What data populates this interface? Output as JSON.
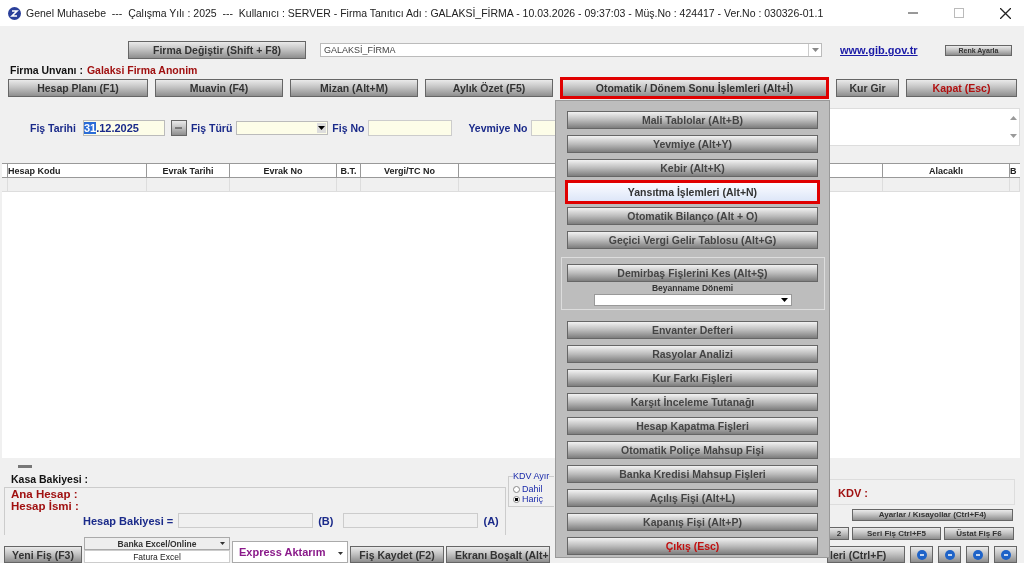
{
  "window": {
    "title": "Genel Muhasebe  ---  Çalışma Yılı : 2025  ---  Kullanıcı : SERVER - Firma Tanıtıcı Adı : GALAKSİ_FİRMA - 10.03.2026 - 09:37:03 - Müş.No : 424417 - Ver.No : 030326-01.1"
  },
  "top_bar": {
    "firma_button": "Firma Değiştir (Shift + F8)",
    "firma_combo": "GALAKSİ_FİRMA",
    "link": "www.gib.gov.tr",
    "color_button": "Renk Ayarla"
  },
  "firma_unvani": {
    "label": "Firma Unvanı :",
    "value": "Galaksi Firma Anonim"
  },
  "toolbar": [
    {
      "label": "Hesap Planı (F1)",
      "kind": "normal",
      "highlighted": false
    },
    {
      "label": "Muavin (F4)",
      "kind": "normal",
      "highlighted": false
    },
    {
      "label": "Mizan (Alt+M)",
      "kind": "normal",
      "highlighted": false
    },
    {
      "label": "Aylık Özet (F5)",
      "kind": "normal",
      "highlighted": false
    },
    {
      "label": "Otomatik / Dönem Sonu İşlemleri (Alt+İ)",
      "kind": "wide",
      "highlighted": true
    },
    {
      "label": "Kur Gir",
      "kind": "small",
      "highlighted": false
    },
    {
      "label": "Kapat (Esc)",
      "kind": "danger",
      "highlighted": false
    }
  ],
  "fis_form": {
    "date_label": "Fiş Tarihi",
    "date_selected": "31",
    "date_rest": ".12.2025",
    "type_label": "Fiş Türü",
    "no_label": "Fiş No",
    "yevmiye_label": "Yevmiye No"
  },
  "grid": {
    "left_columns": [
      "Hesap Kodu",
      "Evrak Tarihi",
      "Evrak No",
      "B.T.",
      "Vergi/TC No"
    ],
    "right_columns": [
      "Alacaklı",
      "B"
    ]
  },
  "menu": {
    "items_top": [
      {
        "label": "Mali Tablolar (Alt+B)",
        "selected": false,
        "kind": "normal"
      },
      {
        "label": "Yevmiye (Alt+Y)",
        "selected": false,
        "kind": "normal"
      },
      {
        "label": "Kebir (Alt+K)",
        "selected": false,
        "kind": "normal"
      },
      {
        "label": "Yansıtma İşlemleri (Alt+N)",
        "selected": true,
        "kind": "normal"
      },
      {
        "label": "Otomatik Bilanço (Alt + O)",
        "selected": false,
        "kind": "normal"
      },
      {
        "label": "Geçici Vergi Gelir Tablosu (Alt+G)",
        "selected": false,
        "kind": "normal"
      }
    ],
    "group": {
      "button": "Demirbaş Fişlerini Kes (Alt+Ş)",
      "label": "Beyanname Dönemi"
    },
    "items_bottom": [
      {
        "label": "Envanter Defteri",
        "selected": false,
        "kind": "normal"
      },
      {
        "label": "Rasyolar Analizi",
        "selected": false,
        "kind": "normal"
      },
      {
        "label": "Kur Farkı Fişleri",
        "selected": false,
        "kind": "normal"
      },
      {
        "label": "Karşıt İnceleme Tutanağı",
        "selected": false,
        "kind": "normal"
      },
      {
        "label": "Hesap Kapatma Fişleri",
        "selected": false,
        "kind": "normal"
      },
      {
        "label": "Otomatik Poliçe Mahsup Fişi",
        "selected": false,
        "kind": "normal"
      },
      {
        "label": "Banka Kredisi Mahsup Fişleri",
        "selected": false,
        "kind": "normal"
      },
      {
        "label": "Açılış Fişi (Alt+L)",
        "selected": false,
        "kind": "normal"
      },
      {
        "label": "Kapanış Fişi (Alt+P)",
        "selected": false,
        "kind": "normal"
      },
      {
        "label": "Çıkış (Esc)",
        "selected": false,
        "kind": "exit"
      }
    ]
  },
  "bottom": {
    "kasa_label": "Kasa Bakiyesi :",
    "ana_hesap_label": "Ana Hesap :",
    "hesap_ismi_label": "Hesap İsmi :",
    "bakiye_label": "Hesap Bakiyesi =",
    "b_mark": "(B)",
    "a_mark": "(A)",
    "kdv_group": {
      "title": "KDV Ayır",
      "options": [
        {
          "label": "Dahil",
          "selected": false
        },
        {
          "label": "Hariç",
          "selected": true
        }
      ]
    },
    "kdv_label": "KDV :",
    "settings_button": "Ayarlar / Kısayollar (Ctrl+F4)",
    "small_buttons": [
      "2",
      "Seri Fiş Ctrl+F5",
      "Üstat Fiş F6"
    ]
  },
  "action_bar": {
    "new_button": "Yeni Fiş (F3)",
    "bank_dropdown": "Banka Excel/Online",
    "invoice_item": "Fatura Excel",
    "express_dropdown": "Express Aktarım",
    "save_button": "Fiş Kaydet (F2)",
    "clear_button": "Ekranı Boşalt (Alt+",
    "search_button": "leri (Ctrl+F)"
  }
}
